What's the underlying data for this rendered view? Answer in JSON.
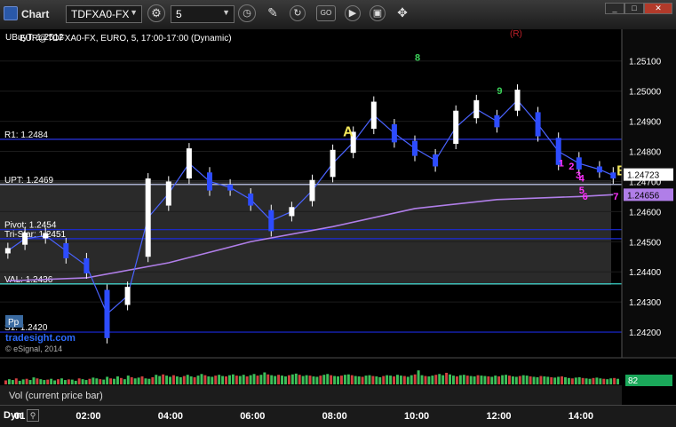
{
  "toolbar": {
    "logo_label": "Chart",
    "symbol": "TDFXA0-FX",
    "interval": "5",
    "min_label": "_",
    "max_label": "□",
    "close_label": "✕",
    "study_icon_label": "GO"
  },
  "chart": {
    "header": "EUR@TDFXA0-FX, EURO, 5, 17:00-17:00 (Dynamic)",
    "overlap_label": "UBuyT: 1.2512",
    "r_marker": "(R)",
    "watermark_line1": "tradesight.com",
    "watermark_line2": "© eSignal, 2014",
    "pp_label": "Pp"
  },
  "levels": [
    {
      "label": "R1: 1.2484",
      "value": 1.2484,
      "color": "#2f3cff"
    },
    {
      "label": "UPT: 1.2469",
      "value": 1.2469,
      "color": "#cfd8ff"
    },
    {
      "label": "Pivot: 1.2454",
      "value": 1.2454,
      "color": "#1a2adc"
    },
    {
      "label": "Tri-Star: 1.2451",
      "value": 1.2451,
      "color": "#1a2adc"
    },
    {
      "label": "VAL: 1.2436",
      "value": 1.2436,
      "color": "#3ad2c8"
    },
    {
      "label": "S1: 1.2420",
      "value": 1.242,
      "color": "#1a2adc"
    }
  ],
  "price_badges": {
    "last": "1.24723",
    "ma": "1.24656"
  },
  "chart_data": {
    "type": "line",
    "title": "EUR@TDFXA0-FX, EURO, 5, 17:00-17:00 (Dynamic)",
    "y_ticks": [
      "1.25100",
      "1.25000",
      "1.24900",
      "1.24800",
      "1.24700",
      "1.24600",
      "1.24500",
      "1.24400",
      "1.24300",
      "1.24200"
    ],
    "ylim": [
      1.2415,
      1.2517
    ],
    "x_ticks": [
      "01",
      "02:00",
      "04:00",
      "06:00",
      "08:00",
      "10:00",
      "12:00",
      "14:00"
    ],
    "price_series": {
      "name": "Close",
      "x": [
        "00:05",
        "00:30",
        "01:00",
        "01:30",
        "02:00",
        "02:30",
        "03:00",
        "03:30",
        "04:00",
        "04:30",
        "05:00",
        "05:30",
        "06:00",
        "06:30",
        "07:00",
        "07:30",
        "08:00",
        "08:30",
        "09:00",
        "09:30",
        "10:00",
        "10:30",
        "11:00",
        "11:30",
        "12:00",
        "12:30",
        "13:00",
        "13:30",
        "14:00",
        "14:30",
        "14:50"
      ],
      "y": [
        1.2447,
        1.2451,
        1.2452,
        1.2447,
        1.2442,
        1.2426,
        1.2432,
        1.2458,
        1.2466,
        1.2476,
        1.247,
        1.2468,
        1.2464,
        1.2457,
        1.246,
        1.2467,
        1.2476,
        1.2483,
        1.2492,
        1.2486,
        1.2481,
        1.2477,
        1.2488,
        1.2494,
        1.249,
        1.2497,
        1.2489,
        1.248,
        1.2476,
        1.2474,
        1.2472
      ]
    },
    "ma_series": {
      "name": "MA",
      "x": [
        "00:05",
        "02:00",
        "04:00",
        "06:00",
        "08:00",
        "10:00",
        "12:00",
        "14:00",
        "14:50"
      ],
      "y": [
        1.2437,
        1.2438,
        1.2443,
        1.245,
        1.2455,
        1.2461,
        1.2464,
        1.2465,
        1.24656
      ]
    },
    "annotations": [
      {
        "text": "A",
        "x": "08:15",
        "y": 1.2485,
        "color": "#f4e85a"
      },
      {
        "text": "B",
        "x": "14:55",
        "y": 1.2472,
        "color": "#f4e85a"
      },
      {
        "text": "1",
        "x": "13:30",
        "y": 1.2475,
        "color": "#ff30ff"
      },
      {
        "text": "2",
        "x": "13:45",
        "y": 1.2474,
        "color": "#ff30ff"
      },
      {
        "text": "3",
        "x": "13:55",
        "y": 1.2471,
        "color": "#ff30ff"
      },
      {
        "text": "4",
        "x": "14:00",
        "y": 1.247,
        "color": "#ff30ff"
      },
      {
        "text": "5",
        "x": "14:00",
        "y": 1.2466,
        "color": "#ff30ff"
      },
      {
        "text": "6",
        "x": "14:05",
        "y": 1.2464,
        "color": "#ff30ff"
      },
      {
        "text": "7",
        "x": "14:50",
        "y": 1.2464,
        "color": "#ff30ff"
      },
      {
        "text": "8",
        "x": "10:00",
        "y": 1.251,
        "color": "#3cd25a"
      },
      {
        "text": "9",
        "x": "12:00",
        "y": 1.2499,
        "color": "#3cd25a"
      }
    ],
    "volume_label": "Vol (current price bar)",
    "volume_last": "82",
    "volume_ylim": [
      0,
      120
    ],
    "volume": [
      20,
      26,
      22,
      30,
      18,
      25,
      28,
      22,
      35,
      30,
      26,
      22,
      24,
      28,
      20,
      26,
      30,
      22,
      25,
      24,
      18,
      30,
      26,
      22,
      28,
      34,
      30,
      26,
      24,
      38,
      30,
      28,
      40,
      32,
      26,
      44,
      36,
      30,
      34,
      40,
      30,
      28,
      36,
      48,
      42,
      50,
      44,
      38,
      46,
      40,
      36,
      42,
      48,
      40,
      36,
      44,
      52,
      46,
      40,
      38,
      44,
      48,
      42,
      40,
      46,
      50,
      44,
      42,
      48,
      40,
      46,
      52,
      44,
      48,
      60,
      50,
      46,
      42,
      48,
      44,
      40,
      46,
      50,
      54,
      48,
      42,
      46,
      44,
      40,
      38,
      44,
      48,
      52,
      46,
      42,
      40,
      44,
      48,
      50,
      46,
      42,
      40,
      38,
      44,
      46,
      42,
      40,
      36,
      42,
      46,
      44,
      40,
      48,
      44,
      42,
      38,
      46,
      50,
      70,
      46,
      42,
      40,
      44,
      48,
      52,
      46,
      58,
      50,
      44,
      40,
      46,
      48,
      44,
      42,
      40,
      46,
      44,
      42,
      40,
      38,
      44,
      40,
      46,
      48,
      44,
      40,
      38,
      42,
      46,
      44,
      40,
      38,
      36,
      42,
      40,
      38,
      36,
      34,
      38,
      40,
      36,
      32,
      30,
      34,
      36,
      32,
      30,
      28,
      32,
      34,
      30,
      28,
      26,
      30,
      32,
      28
    ]
  },
  "footer": {
    "dyn_label": "Dyn"
  }
}
